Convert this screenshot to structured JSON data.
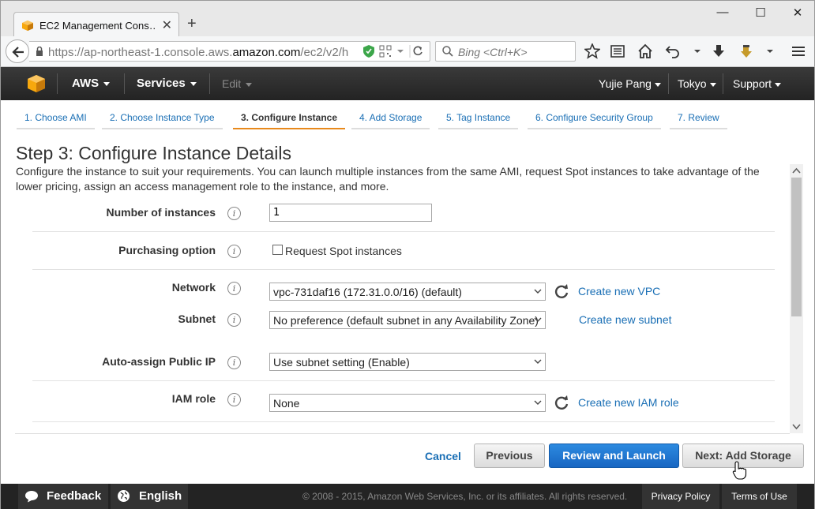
{
  "browser": {
    "tab_title": "EC2 Management Cons…",
    "url_prefix": "https://ap-northeast-1.console.aws.",
    "url_domain": "amazon.com",
    "url_path": "/ec2/v2/h",
    "search_placeholder": "Bing <Ctrl+K>"
  },
  "header": {
    "aws": "AWS",
    "services": "Services",
    "edit": "Edit",
    "user": "Yujie Pang",
    "region": "Tokyo",
    "support": "Support"
  },
  "steps": [
    {
      "label": "1. Choose AMI"
    },
    {
      "label": "2. Choose Instance Type"
    },
    {
      "label": "3. Configure Instance"
    },
    {
      "label": "4. Add Storage"
    },
    {
      "label": "5. Tag Instance"
    },
    {
      "label": "6. Configure Security Group"
    },
    {
      "label": "7. Review"
    }
  ],
  "page": {
    "title": "Step 3: Configure Instance Details",
    "description": "Configure the instance to suit your requirements. You can launch multiple instances from the same AMI, request Spot instances to take advantage of the lower pricing, assign an access management role to the instance, and more."
  },
  "form": {
    "num_instances_label": "Number of instances",
    "num_instances_value": "1",
    "purchasing_label": "Purchasing option",
    "spot_label": "Request Spot instances",
    "network_label": "Network",
    "network_value": "vpc-731daf16 (172.31.0.0/16) (default)",
    "create_vpc": "Create new VPC",
    "subnet_label": "Subnet",
    "subnet_value": "No preference (default subnet in any Availability Zone)",
    "create_subnet": "Create new subnet",
    "public_ip_label": "Auto-assign Public IP",
    "public_ip_value": "Use subnet setting (Enable)",
    "iam_label": "IAM role",
    "iam_value": "None",
    "create_iam": "Create new IAM role"
  },
  "actions": {
    "cancel": "Cancel",
    "previous": "Previous",
    "review_launch": "Review and Launch",
    "next": "Next: Add Storage"
  },
  "footer": {
    "feedback": "Feedback",
    "language": "English",
    "copyright": "© 2008 - 2015, Amazon Web Services, Inc. or its affiliates. All rights reserved.",
    "privacy": "Privacy Policy",
    "terms": "Terms of Use"
  },
  "colors": {
    "accent_orange": "#e8891c",
    "link_blue": "#1a6fb5",
    "primary_button": "#1866c2",
    "header_bg": "#232323"
  }
}
